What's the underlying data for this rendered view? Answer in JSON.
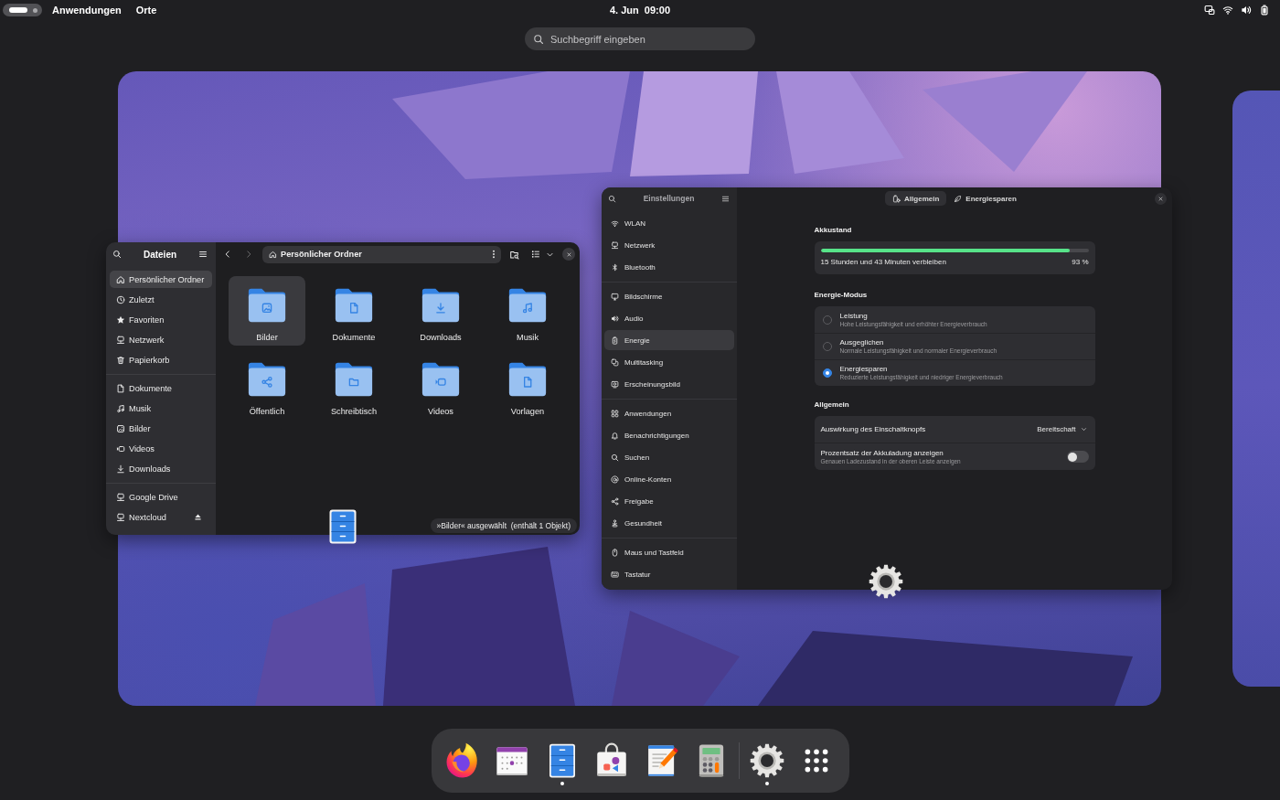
{
  "top_bar": {
    "workspaces": [
      {
        "selected": true
      },
      {
        "selected": false
      }
    ],
    "menus": [
      "Anwendungen",
      "Orte"
    ],
    "clock": "4. Jun  09:00"
  },
  "search": {
    "placeholder": "Suchbegriff eingeben"
  },
  "files_window": {
    "title": "Dateien",
    "active": true,
    "sidebar": [
      {
        "items": [
          {
            "label": "Persönlicher Ordner",
            "selected": true
          },
          {
            "label": "Zuletzt",
            "selected": false
          },
          {
            "label": "Favoriten",
            "selected": false
          },
          {
            "label": "Netzwerk",
            "selected": false
          },
          {
            "label": "Papierkorb",
            "selected": false
          }
        ]
      },
      {
        "items": [
          {
            "label": "Dokumente",
            "selected": false
          },
          {
            "label": "Musik",
            "selected": false
          },
          {
            "label": "Bilder",
            "selected": false
          },
          {
            "label": "Videos",
            "selected": false
          },
          {
            "label": "Downloads",
            "selected": false
          }
        ]
      },
      {
        "items": [
          {
            "label": "Google Drive",
            "selected": false,
            "ejectable": false
          },
          {
            "label": "Nextcloud",
            "selected": false,
            "ejectable": true
          }
        ]
      }
    ],
    "navigation": {
      "back_enabled": true,
      "forward_enabled": false
    },
    "path": "Persönlicher Ordner",
    "folders": [
      {
        "label": "Bilder",
        "selected": true
      },
      {
        "label": "Dokumente",
        "selected": false
      },
      {
        "label": "Downloads",
        "selected": false
      },
      {
        "label": "Musik",
        "selected": false
      },
      {
        "label": "Öffentlich",
        "selected": false
      },
      {
        "label": "Schreibtisch",
        "selected": false
      },
      {
        "label": "Videos",
        "selected": false
      },
      {
        "label": "Vorlagen",
        "selected": false
      }
    ],
    "status": "»Bilder« ausgewählt  (enthält 1 Objekt)"
  },
  "settings_window": {
    "title": "Einstellungen",
    "active": false,
    "sidebar": [
      {
        "items": [
          {
            "label": "WLAN",
            "selected": false
          },
          {
            "label": "Netzwerk",
            "selected": false
          },
          {
            "label": "Bluetooth",
            "selected": false
          }
        ]
      },
      {
        "items": [
          {
            "label": "Bildschirme",
            "selected": false
          },
          {
            "label": "Audio",
            "selected": false
          },
          {
            "label": "Energie",
            "selected": true
          },
          {
            "label": "Multitasking",
            "selected": false
          },
          {
            "label": "Erscheinungsbild",
            "selected": false
          }
        ]
      },
      {
        "items": [
          {
            "label": "Anwendungen",
            "selected": false
          },
          {
            "label": "Benachrichtigungen",
            "selected": false
          },
          {
            "label": "Suchen",
            "selected": false
          },
          {
            "label": "Online-Konten",
            "selected": false
          },
          {
            "label": "Freigabe",
            "selected": false
          },
          {
            "label": "Gesundheit",
            "selected": false
          }
        ]
      },
      {
        "items": [
          {
            "label": "Maus und Tastfeld",
            "selected": false
          },
          {
            "label": "Tastatur",
            "selected": false
          }
        ]
      }
    ],
    "tabs": [
      {
        "label": "Allgemein",
        "selected": true
      },
      {
        "label": "Energiesparen",
        "selected": false
      }
    ],
    "battery": {
      "heading": "Akkustand",
      "level": 0.93,
      "remaining": "15 Stunden und 43 Minuten verbleiben",
      "percent": "93 %"
    },
    "power_mode": {
      "heading": "Energie-Modus",
      "options": [
        {
          "title": "Leistung",
          "description": "Hohe Leistungsfähigkeit und erhöhter Energieverbrauch",
          "selected": false
        },
        {
          "title": "Ausgeglichen",
          "description": "Normale Leistungsfähigkeit und normaler Energieverbrauch",
          "selected": false
        },
        {
          "title": "Energiesparen",
          "description": "Reduzierte Leistungsfähigkeit und niedriger Energieverbrauch",
          "selected": true
        }
      ]
    },
    "general": {
      "heading": "Allgemein",
      "rows": [
        {
          "kind": "dropdown",
          "label": "Auswirkung des Einschaltknopfs",
          "value": "Bereitschaft"
        },
        {
          "kind": "switch",
          "label": "Prozentsatz der Akkuladung anzeigen",
          "description": "Genauen Ladezustand in der oberen Leiste anzeigen",
          "on": false
        }
      ]
    }
  },
  "dock": {
    "favorites": [
      {
        "running": false
      },
      {
        "running": false
      },
      {
        "running": true
      },
      {
        "running": false
      },
      {
        "running": false
      },
      {
        "running": false
      }
    ],
    "others": [
      {
        "running": true
      }
    ]
  }
}
